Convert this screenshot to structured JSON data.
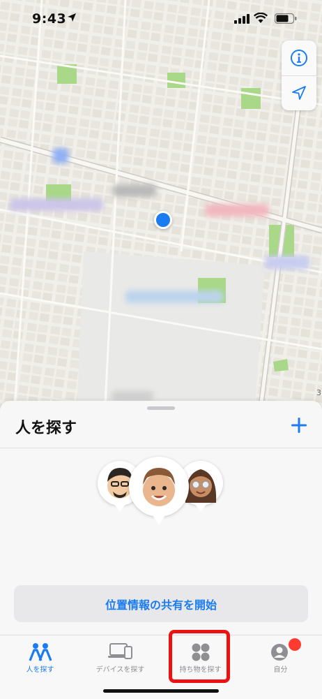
{
  "status_bar": {
    "time": "9:43"
  },
  "map": {
    "scale_digit": "3",
    "accent_color": "#1a7cf0"
  },
  "sheet": {
    "title": "人を探す",
    "share_button": "位置情報の共有を開始"
  },
  "tabs": [
    {
      "label": "人を探す",
      "icon": "people-icon",
      "active": true
    },
    {
      "label": "デバイスを探す",
      "icon": "devices-icon",
      "active": false
    },
    {
      "label": "持ち物を探す",
      "icon": "items-grid-icon",
      "active": false
    },
    {
      "label": "自分",
      "icon": "profile-icon",
      "active": false
    }
  ]
}
